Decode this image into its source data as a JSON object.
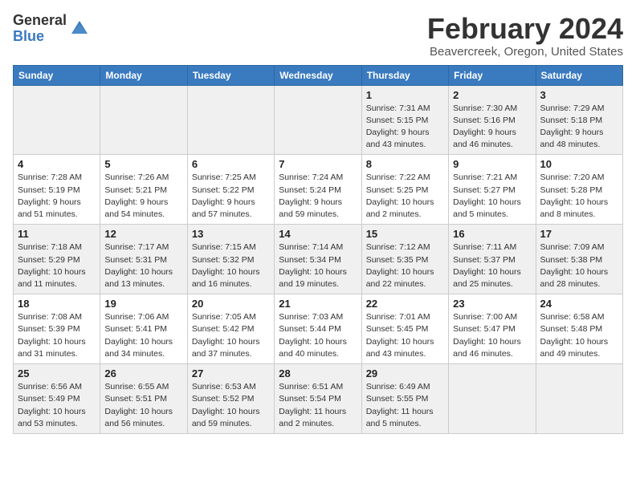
{
  "header": {
    "logo_general": "General",
    "logo_blue": "Blue",
    "month_title": "February 2024",
    "location": "Beavercreek, Oregon, United States"
  },
  "weekdays": [
    "Sunday",
    "Monday",
    "Tuesday",
    "Wednesday",
    "Thursday",
    "Friday",
    "Saturday"
  ],
  "weeks": [
    [
      {
        "day": "",
        "info": ""
      },
      {
        "day": "",
        "info": ""
      },
      {
        "day": "",
        "info": ""
      },
      {
        "day": "",
        "info": ""
      },
      {
        "day": "1",
        "info": "Sunrise: 7:31 AM\nSunset: 5:15 PM\nDaylight: 9 hours\nand 43 minutes."
      },
      {
        "day": "2",
        "info": "Sunrise: 7:30 AM\nSunset: 5:16 PM\nDaylight: 9 hours\nand 46 minutes."
      },
      {
        "day": "3",
        "info": "Sunrise: 7:29 AM\nSunset: 5:18 PM\nDaylight: 9 hours\nand 48 minutes."
      }
    ],
    [
      {
        "day": "4",
        "info": "Sunrise: 7:28 AM\nSunset: 5:19 PM\nDaylight: 9 hours\nand 51 minutes."
      },
      {
        "day": "5",
        "info": "Sunrise: 7:26 AM\nSunset: 5:21 PM\nDaylight: 9 hours\nand 54 minutes."
      },
      {
        "day": "6",
        "info": "Sunrise: 7:25 AM\nSunset: 5:22 PM\nDaylight: 9 hours\nand 57 minutes."
      },
      {
        "day": "7",
        "info": "Sunrise: 7:24 AM\nSunset: 5:24 PM\nDaylight: 9 hours\nand 59 minutes."
      },
      {
        "day": "8",
        "info": "Sunrise: 7:22 AM\nSunset: 5:25 PM\nDaylight: 10 hours\nand 2 minutes."
      },
      {
        "day": "9",
        "info": "Sunrise: 7:21 AM\nSunset: 5:27 PM\nDaylight: 10 hours\nand 5 minutes."
      },
      {
        "day": "10",
        "info": "Sunrise: 7:20 AM\nSunset: 5:28 PM\nDaylight: 10 hours\nand 8 minutes."
      }
    ],
    [
      {
        "day": "11",
        "info": "Sunrise: 7:18 AM\nSunset: 5:29 PM\nDaylight: 10 hours\nand 11 minutes."
      },
      {
        "day": "12",
        "info": "Sunrise: 7:17 AM\nSunset: 5:31 PM\nDaylight: 10 hours\nand 13 minutes."
      },
      {
        "day": "13",
        "info": "Sunrise: 7:15 AM\nSunset: 5:32 PM\nDaylight: 10 hours\nand 16 minutes."
      },
      {
        "day": "14",
        "info": "Sunrise: 7:14 AM\nSunset: 5:34 PM\nDaylight: 10 hours\nand 19 minutes."
      },
      {
        "day": "15",
        "info": "Sunrise: 7:12 AM\nSunset: 5:35 PM\nDaylight: 10 hours\nand 22 minutes."
      },
      {
        "day": "16",
        "info": "Sunrise: 7:11 AM\nSunset: 5:37 PM\nDaylight: 10 hours\nand 25 minutes."
      },
      {
        "day": "17",
        "info": "Sunrise: 7:09 AM\nSunset: 5:38 PM\nDaylight: 10 hours\nand 28 minutes."
      }
    ],
    [
      {
        "day": "18",
        "info": "Sunrise: 7:08 AM\nSunset: 5:39 PM\nDaylight: 10 hours\nand 31 minutes."
      },
      {
        "day": "19",
        "info": "Sunrise: 7:06 AM\nSunset: 5:41 PM\nDaylight: 10 hours\nand 34 minutes."
      },
      {
        "day": "20",
        "info": "Sunrise: 7:05 AM\nSunset: 5:42 PM\nDaylight: 10 hours\nand 37 minutes."
      },
      {
        "day": "21",
        "info": "Sunrise: 7:03 AM\nSunset: 5:44 PM\nDaylight: 10 hours\nand 40 minutes."
      },
      {
        "day": "22",
        "info": "Sunrise: 7:01 AM\nSunset: 5:45 PM\nDaylight: 10 hours\nand 43 minutes."
      },
      {
        "day": "23",
        "info": "Sunrise: 7:00 AM\nSunset: 5:47 PM\nDaylight: 10 hours\nand 46 minutes."
      },
      {
        "day": "24",
        "info": "Sunrise: 6:58 AM\nSunset: 5:48 PM\nDaylight: 10 hours\nand 49 minutes."
      }
    ],
    [
      {
        "day": "25",
        "info": "Sunrise: 6:56 AM\nSunset: 5:49 PM\nDaylight: 10 hours\nand 53 minutes."
      },
      {
        "day": "26",
        "info": "Sunrise: 6:55 AM\nSunset: 5:51 PM\nDaylight: 10 hours\nand 56 minutes."
      },
      {
        "day": "27",
        "info": "Sunrise: 6:53 AM\nSunset: 5:52 PM\nDaylight: 10 hours\nand 59 minutes."
      },
      {
        "day": "28",
        "info": "Sunrise: 6:51 AM\nSunset: 5:54 PM\nDaylight: 11 hours\nand 2 minutes."
      },
      {
        "day": "29",
        "info": "Sunrise: 6:49 AM\nSunset: 5:55 PM\nDaylight: 11 hours\nand 5 minutes."
      },
      {
        "day": "",
        "info": ""
      },
      {
        "day": "",
        "info": ""
      }
    ]
  ]
}
